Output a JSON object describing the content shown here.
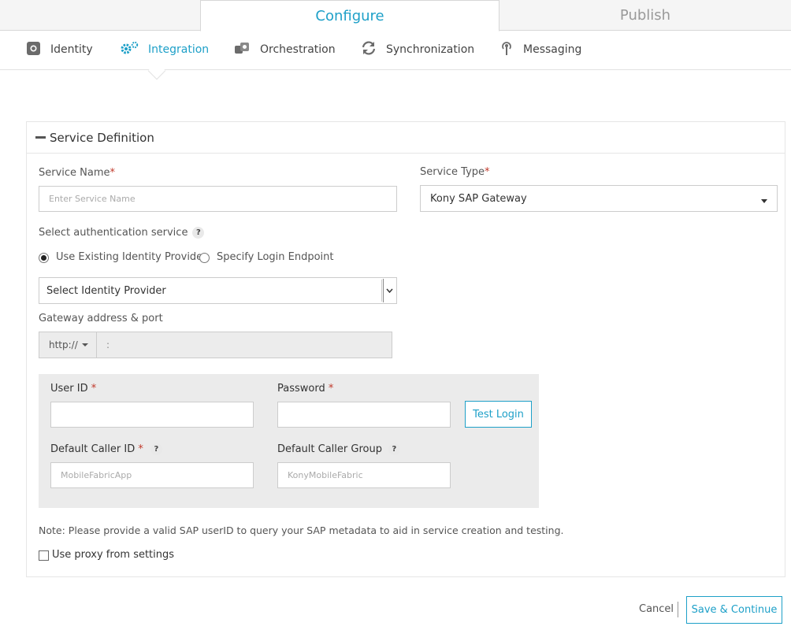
{
  "top_tabs": {
    "configure": "Configure",
    "publish": "Publish"
  },
  "nav": {
    "identity": "Identity",
    "integration": "Integration",
    "orchestration": "Orchestration",
    "synchronization": "Synchronization",
    "messaging": "Messaging"
  },
  "card": {
    "title": "Service Definition"
  },
  "form": {
    "service_name_label": "Service Name",
    "service_name_placeholder": "Enter Service Name",
    "service_type_label": "Service Type",
    "service_type_value": "Kony SAP Gateway",
    "auth_label": "Select authentication service",
    "radio_existing": "Use Existing Identity Provider",
    "radio_login": "Specify Login Endpoint",
    "identity_provider_value": "Select Identity Provider",
    "gateway_label": "Gateway address & port",
    "protocol_value": "http://",
    "host_port_separator": ":",
    "user_id_label": "User ID",
    "password_label": "Password",
    "test_login": "Test Login",
    "caller_id_label": "Default Caller ID",
    "caller_id_placeholder": "MobileFabricApp",
    "caller_group_label": "Default Caller Group",
    "caller_group_placeholder": "KonyMobileFabric",
    "note": "Note: Please provide a valid SAP userID to query your SAP metadata to aid in service creation and testing.",
    "proxy_label": "Use proxy from settings",
    "help_glyph": "?",
    "required_marker": "*"
  },
  "footer": {
    "cancel": "Cancel",
    "save": "Save & Continue"
  },
  "colors": {
    "accent": "#1ea0c8",
    "required": "#c0392b"
  }
}
